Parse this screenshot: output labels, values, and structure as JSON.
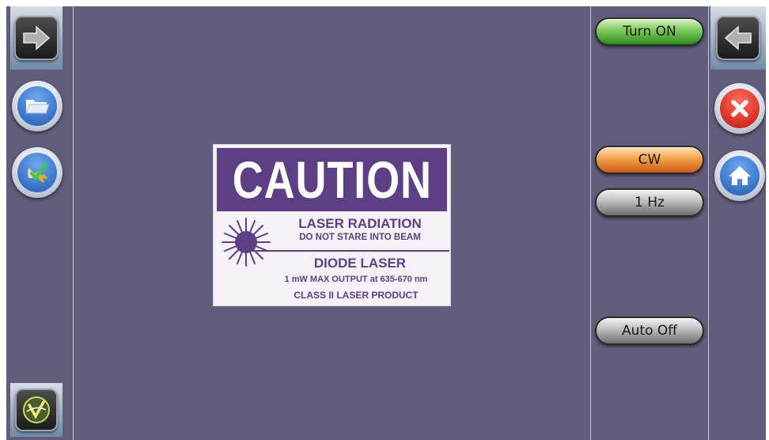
{
  "colors": {
    "screen_bg": "#625c7d",
    "sign_purple": "#5e3f85",
    "turn_on_green": "#5db33f",
    "cw_orange": "#ee8a2f",
    "gray_button": "#a9a9a9",
    "close_red": "#e0241c",
    "home_blue": "#2a6fc9",
    "file_blue": "#2f6fc4"
  },
  "left_sidebar": {
    "top_button_icon": "arrow-right-icon",
    "folder_icon": "folder-icon",
    "tools_icon": "plug-check-icon",
    "logo_icon": "veex-logo-icon"
  },
  "right_sidebar": {
    "top_button_icon": "arrow-left-icon",
    "close_icon": "close-icon",
    "home_icon": "home-icon"
  },
  "controls": {
    "turn_on_label": "Turn ON",
    "cw_label": "CW",
    "freq_label": "1 Hz",
    "auto_off_label": "Auto Off"
  },
  "caution_sign": {
    "header": "CAUTION",
    "line1": "LASER RADIATION",
    "line2": "DO NOT STARE INTO BEAM",
    "line3": "DIODE LASER",
    "line4": "1 mW MAX OUTPUT at 635-670 nm",
    "line5": "CLASS II LASER PRODUCT",
    "symbol_icon": "laser-starburst-icon"
  }
}
